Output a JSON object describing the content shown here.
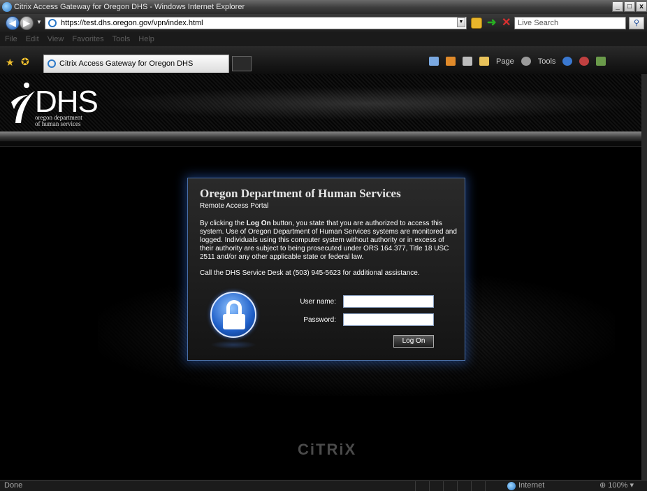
{
  "window": {
    "title": "Citrix Access Gateway for Oregon DHS - Windows Internet Explorer",
    "buttons": [
      "_",
      "□",
      "x"
    ]
  },
  "address_bar": {
    "url": "https://test.dhs.oregon.gov/vpn/index.html",
    "search_placeholder": "Live Search"
  },
  "menu": [
    "File",
    "Edit",
    "View",
    "Favorites",
    "Tools",
    "Help"
  ],
  "tab": {
    "label": "Citrix Access Gateway for Oregon DHS"
  },
  "command_bar": {
    "page": "Page",
    "tools": "Tools"
  },
  "header": {
    "logo_text": "DHS",
    "logo_sub_1": "oregon department",
    "logo_sub_2": "of human services"
  },
  "login": {
    "title": "Oregon Department of Human Services",
    "subtitle": "Remote Access Portal",
    "notice_pre": "By clicking the ",
    "notice_bold": "Log On",
    "notice_post": " button, you state that you are authorized to access this system. Use of Oregon Department of Human Services systems are monitored and logged. Individuals using this computer system without authority or in excess of their authority are subject to being prosecuted under ORS 164.377, Title 18 USC 2511 and/or any other applicable state or federal law.",
    "call": "Call the DHS Service Desk at (503) 945-5623 for additional assistance.",
    "username_label": "User name:",
    "password_label": "Password:",
    "username_value": "",
    "password_value": "",
    "logon_button": "Log On"
  },
  "footer_logo": "CiTRiX",
  "status": {
    "text": "Done",
    "zone": "Internet",
    "zoom": "100%"
  },
  "colors": {
    "panel_border": "#4a70a8",
    "glow": "#285ab4",
    "background": "#000000"
  }
}
